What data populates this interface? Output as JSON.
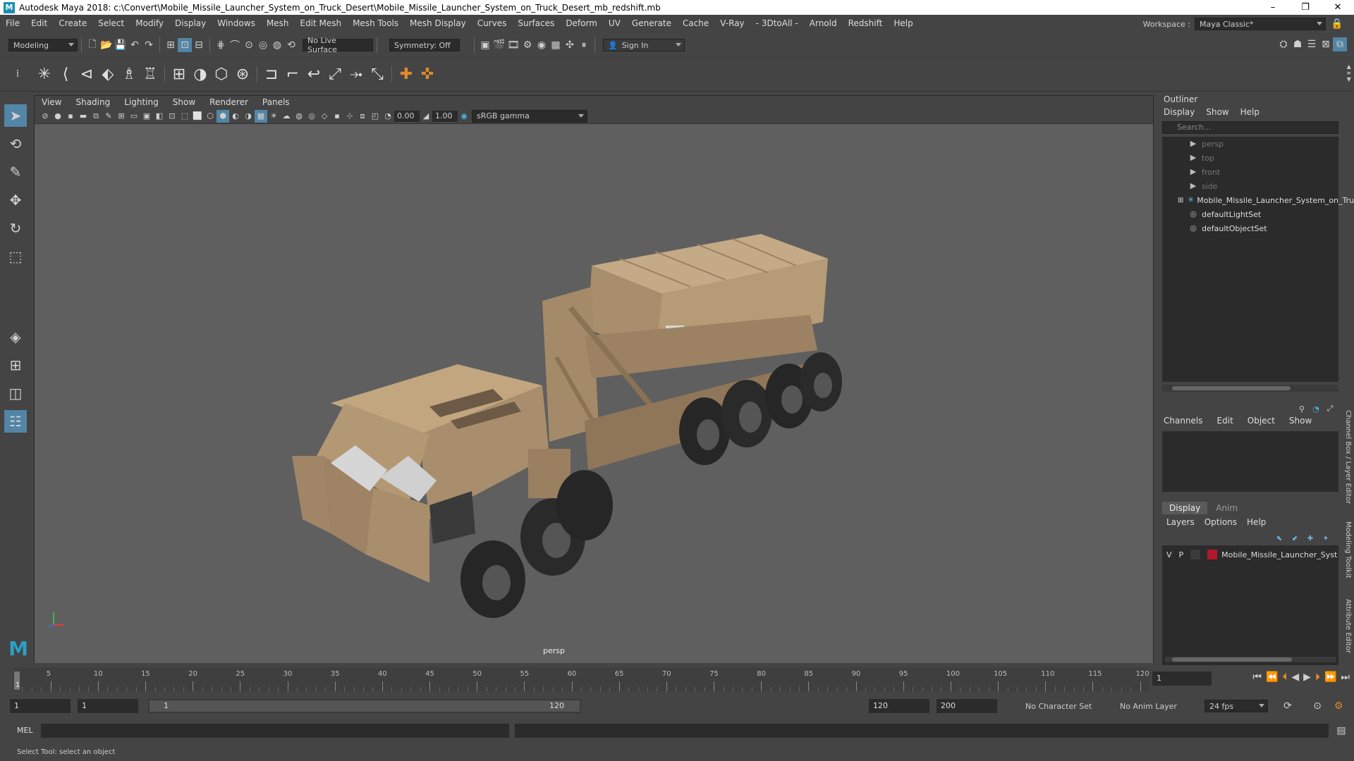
{
  "window": {
    "title": "Autodesk Maya 2018: c:\\Convert\\Mobile_Missile_Launcher_System_on_Truck_Desert\\Mobile_Missile_Launcher_System_on_Truck_Desert_mb_redshift.mb",
    "minimize": "–",
    "maximize": "❐",
    "close": "✕"
  },
  "menubar": {
    "items": [
      "File",
      "Edit",
      "Create",
      "Select",
      "Modify",
      "Display",
      "Windows",
      "Mesh",
      "Edit Mesh",
      "Mesh Tools",
      "Mesh Display",
      "Curves",
      "Surfaces",
      "Deform",
      "UV",
      "Generate",
      "Cache",
      "V-Ray",
      "- 3DtoAll -",
      "Arnold",
      "Redshift",
      "Help"
    ],
    "workspace_label": "Workspace :",
    "workspace_value": "Maya Classic*"
  },
  "statusline": {
    "mode": "Modeling",
    "live_surface": "No Live Surface",
    "symmetry": "Symmetry: Off",
    "sign_in": "Sign In"
  },
  "panel": {
    "menu": [
      "View",
      "Shading",
      "Lighting",
      "Show",
      "Renderer",
      "Panels"
    ],
    "exposure": "0.00",
    "gamma": "1.00",
    "color_space": "sRGB gamma",
    "camera_label": "persp"
  },
  "outliner": {
    "title": "Outliner",
    "menu": [
      "Display",
      "Show",
      "Help"
    ],
    "search_placeholder": "Search...",
    "items": [
      {
        "label": "persp",
        "dim": true,
        "icon": "camera-icon"
      },
      {
        "label": "top",
        "dim": true,
        "icon": "camera-icon"
      },
      {
        "label": "front",
        "dim": true,
        "icon": "camera-icon"
      },
      {
        "label": "side",
        "dim": true,
        "icon": "camera-icon"
      },
      {
        "label": "Mobile_Missile_Launcher_System_on_Tru",
        "dim": false,
        "icon": "group-icon"
      },
      {
        "label": "defaultLightSet",
        "dim": false,
        "icon": "set-icon"
      },
      {
        "label": "defaultObjectSet",
        "dim": false,
        "icon": "set-icon"
      }
    ]
  },
  "channelbox": {
    "menu": [
      "Channels",
      "Edit",
      "Object",
      "Show"
    ]
  },
  "layers": {
    "tabs": [
      "Display",
      "Anim"
    ],
    "menu": [
      "Layers",
      "Options",
      "Help"
    ],
    "row": {
      "v": "V",
      "p": "P",
      "name": "Mobile_Missile_Launcher_Syst",
      "color": "#b0182e"
    }
  },
  "side_tabs": [
    "Channel Box / Layer Editor",
    "Modeling Toolkit",
    "Attribute Editor"
  ],
  "timeline": {
    "labels": [
      "5",
      "10",
      "15",
      "20",
      "25",
      "30",
      "35",
      "40",
      "45",
      "50",
      "55",
      "60",
      "65",
      "70",
      "75",
      "80",
      "85",
      "90",
      "95",
      "100",
      "105",
      "110",
      "115",
      "120"
    ],
    "current_frame_marker": "1",
    "current_frame": "1"
  },
  "range": {
    "start": "1",
    "playback_start": "1",
    "slider_start": "1",
    "slider_end": "120",
    "playback_end": "120",
    "end": "200",
    "character_set": "No Character Set",
    "anim_layer": "No Anim Layer",
    "fps": "24 fps"
  },
  "cmdline": {
    "label": "MEL"
  },
  "helpline": {
    "text": "Select Tool: select an object"
  }
}
